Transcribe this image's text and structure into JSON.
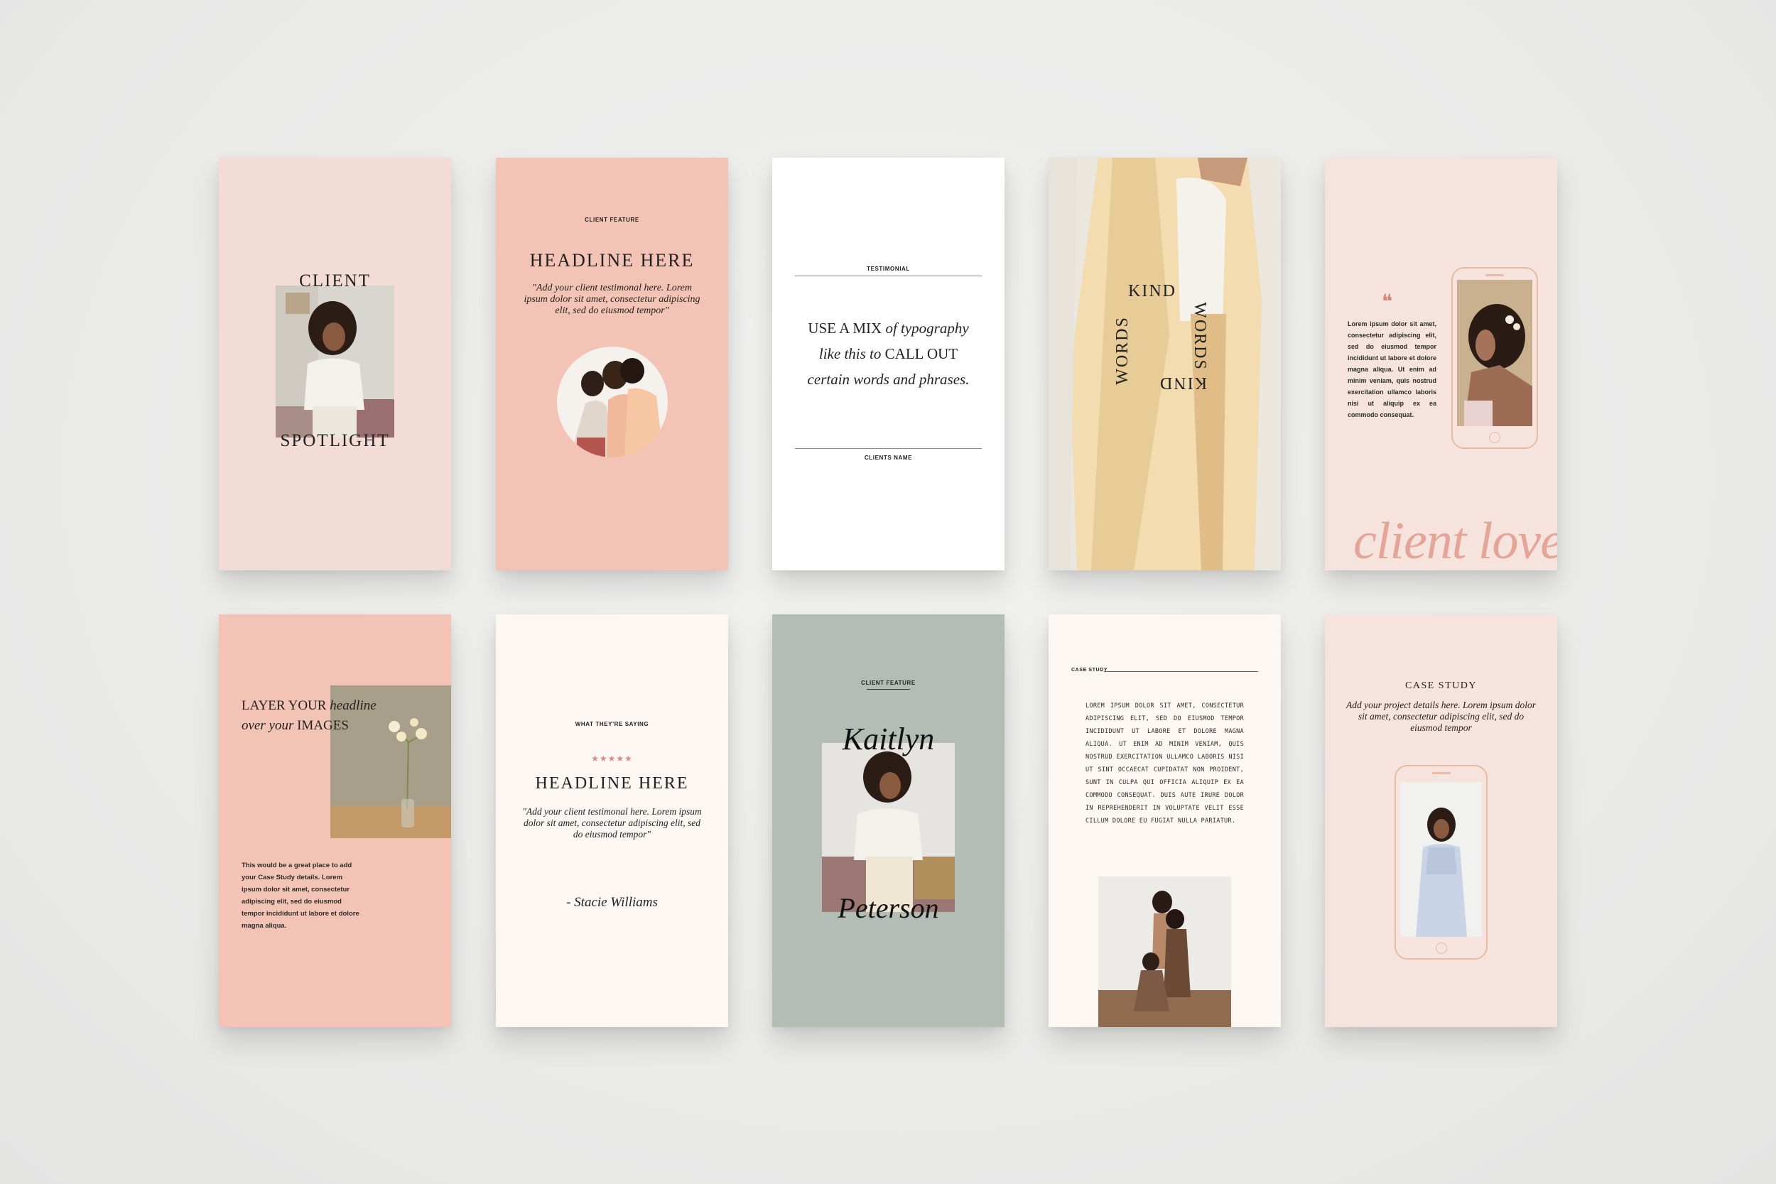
{
  "colors": {
    "background": "#ebebea",
    "blush": "#f3dcd5",
    "peach": "#f3c4b5",
    "white": "#ffffff",
    "sage": "#b3bdb6",
    "cream": "#fdf7f3",
    "rose_text": "#d4857a"
  },
  "cards": {
    "client_spotlight": {
      "line1": "CLIENT",
      "line2": "SPOTLIGHT"
    },
    "client_feature_a": {
      "label": "CLIENT FEATURE",
      "headline": "HEADLINE HERE",
      "quote": "\"Add your client testimonal here. Lorem ipsum dolor sit amet, consectetur adipiscing elit, sed do eiusmod tempor\""
    },
    "testimonial": {
      "label": "TESTIMONIAL",
      "line1_plain": "USE A MIX ",
      "line1_italic": "of typography",
      "line2_italic": "like this to ",
      "line2_plain": "CALL OUT",
      "line3_italic": "certain words and phrases.",
      "footer": "CLIENTS NAME"
    },
    "kind_words": {
      "a": "KIND",
      "b": "WORDS",
      "c": "WORDS",
      "d": "KIND"
    },
    "client_love": {
      "quote_mark": "❝",
      "body": "Lorem ipsum dolor sit amet, consectetur adipiscing elit, sed do eiusmod tempor incididunt ut labore et dolore magna aliqua. Ut enim ad minim veniam, quis nostrud exercitation ullamco laboris nisi ut aliquip ex ea commodo consequat.",
      "script": "client love"
    },
    "layer_images": {
      "h1_plain": "LAYER YOUR ",
      "h1_italic": "headline",
      "h2_italic": "over your ",
      "h2_plain": "IMAGES",
      "body": "This would be a great place to add your Case Study details. Lorem ipsum dolor sit amet, consectetur adipiscing elit, sed do eiusmod tempor incididunt ut labore et dolore magna aliqua."
    },
    "what_theyre_saying": {
      "label": "WHAT THEY'RE SAYING",
      "stars": "★★★★★",
      "headline": "HEADLINE HERE",
      "quote": "\"Add your client testimonal here. Lorem ipsum dolor sit amet, consectetur adipiscing elit, sed do eiusmod tempor\"",
      "signature": "- Stacie Williams"
    },
    "client_feature_b": {
      "label": "CLIENT FEATURE",
      "first": "Kaitlyn",
      "last": "Peterson"
    },
    "case_study_a": {
      "label": "CASE STUDY",
      "body": "LOREM IPSUM DOLOR SIT AMET, CONSECTETUR ADIPISCING ELIT, SED DO EIUSMOD TEMPOR INCIDIDUNT UT LABORE ET DOLORE MAGNA ALIQUA. UT ENIM AD MINIM VENIAM, QUIS NOSTRUD EXERCITATION ULLAMCO LABORIS NISI UT SINT OCCAECAT CUPIDATAT NON PROIDENT, SUNT IN CULPA QUI OFFICIA ALIQUIP EX EA COMMODO CONSEQUAT. DUIS AUTE IRURE DOLOR IN REPREHENDERIT IN VOLUPTATE VELIT ESSE CILLUM DOLORE EU FUGIAT NULLA PARIATUR."
    },
    "case_study_b": {
      "label": "CASE STUDY",
      "body": "Add your project details here. Lorem ipsum dolor sit amet, consectetur adipiscing elit, sed do eiusmod tempor"
    }
  }
}
